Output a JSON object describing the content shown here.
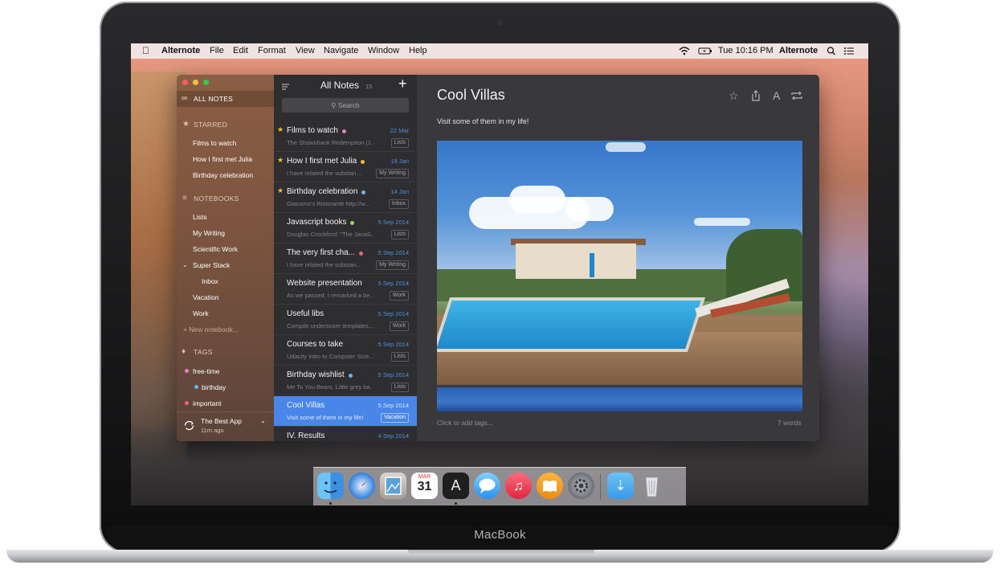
{
  "device": {
    "brand": "MacBook"
  },
  "menubar": {
    "apple": "",
    "app_name": "Alternote",
    "menus": [
      "File",
      "Edit",
      "Format",
      "View",
      "Navigate",
      "Window",
      "Help"
    ],
    "clock": "Tue 10:16 PM",
    "user": "Alternote",
    "wifi_icon": "wifi-icon",
    "battery_icon": "battery-icon",
    "spotlight_icon": "search-icon",
    "notification_icon": "list-icon"
  },
  "sidebar": {
    "all_notes": "ALL NOTES",
    "starred_header": "STARRED",
    "starred": [
      "Films to watch",
      "How I first met Julia",
      "Birthday celebration"
    ],
    "notebooks_header": "NOTEBOOKS",
    "notebooks": [
      "Lists",
      "My Writing",
      "Scientific Work",
      "Super Stack",
      "Inbox",
      "Vacation",
      "Work"
    ],
    "new_notebook": "+ New notebook...",
    "tags_header": "TAGS",
    "tags": [
      {
        "label": "free-time",
        "color": "#e97fc0"
      },
      {
        "label": "birthday",
        "color": "#6fb2f0"
      },
      {
        "label": "important",
        "color": "#f2637a"
      }
    ],
    "account": {
      "name": "The Best App",
      "time": "11m ago"
    }
  },
  "notelist": {
    "title": "All Notes",
    "count": "15",
    "add": "+",
    "search_placeholder": "Search",
    "notes": [
      {
        "title": "Films to watch",
        "date": "22 Mar",
        "snippet": "The Shawshank Redemption (1...",
        "notebook": "Lists",
        "starred": true,
        "dot": "#e97fc0"
      },
      {
        "title": "How I first met Julia",
        "date": "18 Jan",
        "snippet": "I have related the substan...",
        "notebook": "My Writing",
        "starred": true,
        "dot": "#f5b53a"
      },
      {
        "title": "Birthday celebration",
        "date": "14 Jan",
        "snippet": "Giacomo's Ristorante http://w...",
        "notebook": "Inbox",
        "starred": true,
        "dot": "#6fb2f0"
      },
      {
        "title": "Javascript books",
        "date": "5 Sep 2014",
        "snippet": "Douglas Crockford: \"The JavaS...",
        "notebook": "Lists",
        "starred": false,
        "dot": "#9bd94a"
      },
      {
        "title": "The very first cha...",
        "date": "5 Sep 2014",
        "snippet": "I have related the substan...",
        "notebook": "My Writing",
        "starred": false,
        "dot": "#f2637a"
      },
      {
        "title": "Website presentation",
        "date": "5 Sep 2014",
        "snippet": "As we passed, I remarked a be...",
        "notebook": "Work",
        "starred": false,
        "dot": ""
      },
      {
        "title": "Useful libs",
        "date": "5 Sep 2014",
        "snippet": "Compile underscore templates...",
        "notebook": "Work",
        "starred": false,
        "dot": ""
      },
      {
        "title": "Courses to take",
        "date": "5 Sep 2014",
        "snippet": "Udacity Intro to Computer Scie...",
        "notebook": "Lists",
        "starred": false,
        "dot": ""
      },
      {
        "title": "Birthday wishlist",
        "date": "5 Sep 2014",
        "snippet": "Me To You Bears. Little grey ba...",
        "notebook": "Lists",
        "starred": false,
        "dot": "#6fb2f0"
      },
      {
        "title": "Cool Villas",
        "date": "5 Sep 2014",
        "snippet": "Visit some of them in my life!",
        "notebook": "Vacation",
        "starred": false,
        "dot": "",
        "selected": true
      },
      {
        "title": "IV. Results",
        "date": "4 Sep 2014",
        "snippet": "",
        "notebook": "",
        "starred": false,
        "dot": ""
      }
    ]
  },
  "editor": {
    "title": "Cool Villas",
    "body": "Visit some of them in my life!",
    "tags_placeholder": "Click to add tags...",
    "word_count": "7 words",
    "toolbar": [
      "star-icon",
      "share-icon",
      "font-icon",
      "sync-icon"
    ]
  },
  "dock": {
    "apps": [
      "finder-icon",
      "safari-icon",
      "preview-icon",
      "calendar-icon",
      "alternote-icon",
      "messages-icon",
      "itunes-icon",
      "ibooks-icon",
      "system-preferences-icon",
      "downloads-folder-icon",
      "trash-icon"
    ],
    "calendar_month": "MAR",
    "calendar_day": "31",
    "alternote_glyph": "A"
  }
}
